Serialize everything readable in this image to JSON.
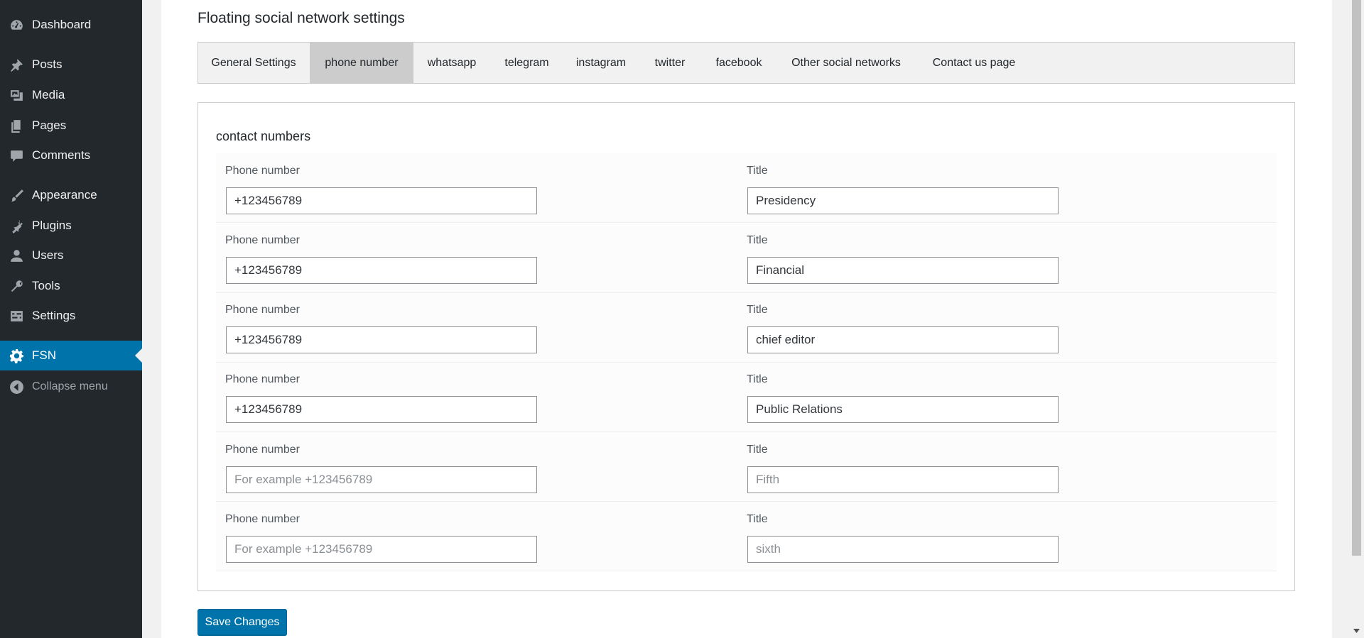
{
  "sidebar": {
    "items": [
      {
        "label": "Dashboard",
        "icon": "dashboard-icon"
      },
      {
        "label": "Posts",
        "icon": "pin-icon"
      },
      {
        "label": "Media",
        "icon": "media-icon"
      },
      {
        "label": "Pages",
        "icon": "pages-icon"
      },
      {
        "label": "Comments",
        "icon": "comment-icon"
      },
      {
        "label": "Appearance",
        "icon": "brush-icon"
      },
      {
        "label": "Plugins",
        "icon": "plug-icon"
      },
      {
        "label": "Users",
        "icon": "user-icon"
      },
      {
        "label": "Tools",
        "icon": "wrench-icon"
      },
      {
        "label": "Settings",
        "icon": "settings-icon"
      },
      {
        "label": "FSN",
        "icon": "gear-icon"
      }
    ],
    "collapse_label": "Collapse menu",
    "current": "FSN"
  },
  "page": {
    "title": "Floating social network settings"
  },
  "tabs": [
    {
      "label": "General Settings",
      "active": false
    },
    {
      "label": "phone number",
      "active": true
    },
    {
      "label": "whatsapp",
      "active": false
    },
    {
      "label": "telegram",
      "active": false
    },
    {
      "label": "instagram",
      "active": false
    },
    {
      "label": "twitter",
      "active": false
    },
    {
      "label": "facebook",
      "active": false
    },
    {
      "label": "Other social networks",
      "active": false
    },
    {
      "label": "Contact us page",
      "active": false
    }
  ],
  "section": {
    "title": "contact numbers",
    "phone_label": "Phone number",
    "title_label": "Title",
    "rows": [
      {
        "phone": "+123456789",
        "phone_placeholder": "",
        "title": "Presidency",
        "title_placeholder": ""
      },
      {
        "phone": "+123456789",
        "phone_placeholder": "",
        "title": "Financial",
        "title_placeholder": ""
      },
      {
        "phone": "+123456789",
        "phone_placeholder": "",
        "title": "chief editor",
        "title_placeholder": ""
      },
      {
        "phone": "+123456789",
        "phone_placeholder": "",
        "title": "Public Relations",
        "title_placeholder": ""
      },
      {
        "phone": "",
        "phone_placeholder": "For example +123456789",
        "title": "",
        "title_placeholder": "Fifth"
      },
      {
        "phone": "",
        "phone_placeholder": "For example +123456789",
        "title": "",
        "title_placeholder": "sixth"
      }
    ]
  },
  "save_button": "Save Changes",
  "colors": {
    "sidebar_bg": "#23282d",
    "accent": "#0073aa",
    "active_tab": "#cccccc"
  }
}
